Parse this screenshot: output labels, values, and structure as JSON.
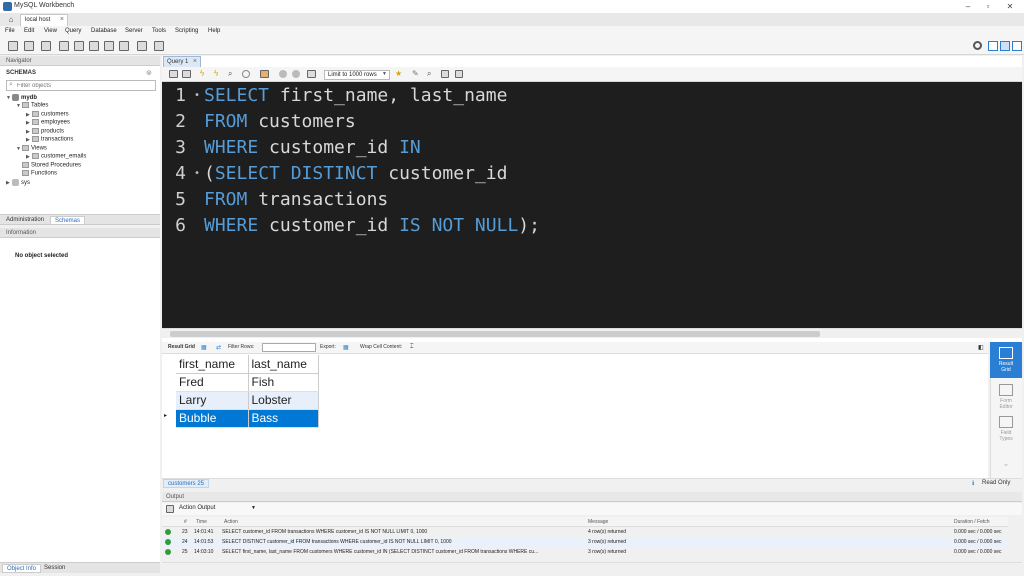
{
  "window": {
    "title": "MySQL Workbench",
    "controls": [
      "–",
      "▫",
      "✕"
    ]
  },
  "connection_tab": {
    "label": "local host",
    "close": "×"
  },
  "menu": [
    "File",
    "Edit",
    "View",
    "Query",
    "Database",
    "Server",
    "Tools",
    "Scripting",
    "Help"
  ],
  "navigator": {
    "header": "Navigator",
    "schemas_title": "SCHEMAS",
    "filter_placeholder": "Filter objects",
    "tree": {
      "schema": "mydb",
      "tables_label": "Tables",
      "tables": [
        "customers",
        "employees",
        "products",
        "transactions"
      ],
      "views_label": "Views",
      "views": [
        "customer_emails"
      ],
      "stored_procedures": "Stored Procedures",
      "functions": "Functions",
      "other_schema": "sys"
    }
  },
  "left_tabs": {
    "admin": "Administration",
    "schemas": "Schemas"
  },
  "information": {
    "header": "Information",
    "empty": "No object selected"
  },
  "left_bottom_tabs": {
    "object_info": "Object Info",
    "session": "Session"
  },
  "query_tab": {
    "label": "Query 1",
    "close": "×"
  },
  "editor_toolbar": {
    "limit": "Limit to 1000 rows"
  },
  "editor": {
    "lines": [
      {
        "n": "1",
        "parts": [
          {
            "k": "SELECT"
          },
          {
            "t": " first_name, last_name"
          }
        ]
      },
      {
        "n": "2",
        "parts": [
          {
            "k": "FROM"
          },
          {
            "t": " customers"
          }
        ]
      },
      {
        "n": "3",
        "parts": [
          {
            "k": "WHERE"
          },
          {
            "t": " customer_id "
          },
          {
            "k": "IN"
          }
        ]
      },
      {
        "n": "4",
        "parts": [
          {
            "t": "("
          },
          {
            "k": "SELECT DISTINCT"
          },
          {
            "t": " customer_id"
          }
        ]
      },
      {
        "n": "5",
        "parts": [
          {
            "k": "FROM"
          },
          {
            "t": " transactions"
          }
        ]
      },
      {
        "n": "6",
        "parts": [
          {
            "k": "WHERE"
          },
          {
            "t": " customer_id "
          },
          {
            "k": "IS NOT NULL"
          },
          {
            "t": ");"
          }
        ]
      }
    ]
  },
  "result_toolbar": {
    "result_grid": "Result Grid",
    "filter_rows": "Filter Rows:",
    "export": "Export:",
    "wrap": "Wrap Cell Content:"
  },
  "result": {
    "columns": [
      "first_name",
      "last_name"
    ],
    "rows": [
      [
        "Fred",
        "Fish"
      ],
      [
        "Larry",
        "Lobster"
      ],
      [
        "Bubble",
        "Bass"
      ]
    ],
    "selected_row": 2,
    "tab": "customers 25",
    "read_only": "Read Only"
  },
  "side_panel": {
    "result_grid": [
      "Result",
      "Grid"
    ],
    "form_editor": [
      "Form",
      "Editor"
    ],
    "field_types": [
      "Field",
      "Types"
    ]
  },
  "output": {
    "header": "Output",
    "selector": "Action Output",
    "columns": {
      "num": "#",
      "time": "Time",
      "action": "Action",
      "message": "Message",
      "duration": "Duration / Fetch"
    },
    "rows": [
      {
        "num": "23",
        "time": "14:01:41",
        "action": "SELECT customer_id FROM transactions WHERE customer_id IS NOT NULL LIMIT 0, 1000",
        "message": "4 row(s) returned",
        "duration": "0.000 sec / 0.000 sec"
      },
      {
        "num": "24",
        "time": "14:01:53",
        "action": "SELECT DISTINCT customer_id FROM transactions WHERE customer_id IS NOT NULL LIMIT 0, 1000",
        "message": "3 row(s) returned",
        "duration": "0.000 sec / 0.000 sec"
      },
      {
        "num": "25",
        "time": "14:03:10",
        "action": "SELECT first_name, last_name FROM customers WHERE customer_id IN  (SELECT DISTINCT customer_id FROM transactions WHERE cu...",
        "message": "3 row(s) returned",
        "duration": "0.000 sec / 0.000 sec"
      }
    ]
  },
  "colors": {
    "keyword": "#569cd6",
    "editor_bg": "#1e1e1e",
    "selection": "#0078d4",
    "ok": "#2e9d3a"
  }
}
